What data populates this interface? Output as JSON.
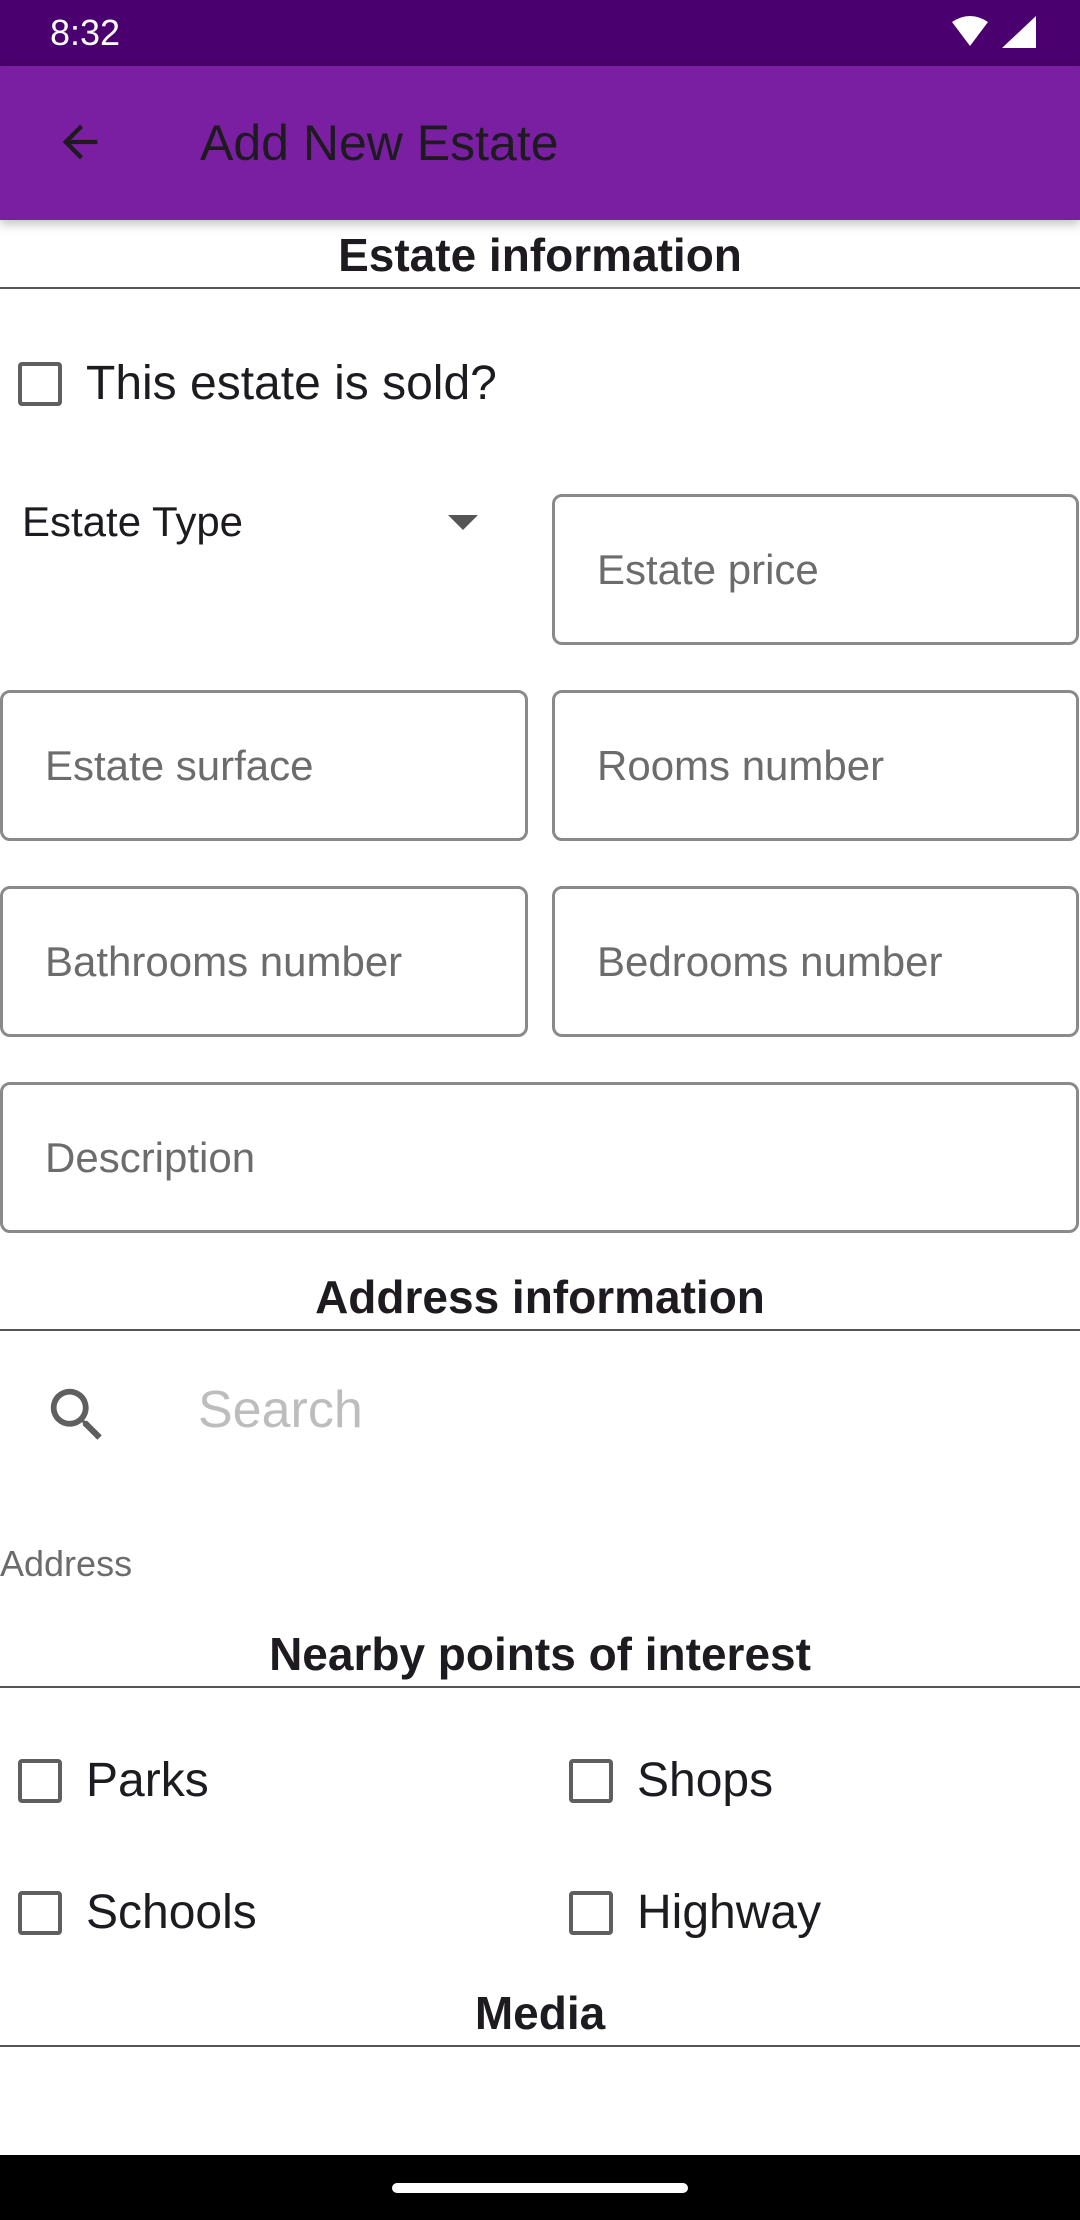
{
  "status_bar": {
    "time": "8:32",
    "icons": [
      "wifi-icon",
      "cell-signal-icon"
    ]
  },
  "app_bar": {
    "title": "Add New Estate",
    "back_icon": "arrow-back-icon",
    "background": "#7b1fa2",
    "status_background": "#4a006e"
  },
  "estate_section": {
    "title": "Estate information",
    "sold_checkbox": {
      "label": "This estate is sold?",
      "checked": false
    },
    "type_dropdown": {
      "label": "Estate Type"
    },
    "fields": {
      "price": {
        "placeholder": "Estate price",
        "value": ""
      },
      "surface": {
        "placeholder": "Estate surface",
        "value": ""
      },
      "rooms": {
        "placeholder": "Rooms number",
        "value": ""
      },
      "bathrooms": {
        "placeholder": "Bathrooms number",
        "value": ""
      },
      "bedrooms": {
        "placeholder": "Bedrooms number",
        "value": ""
      },
      "description": {
        "placeholder": "Description",
        "value": ""
      }
    }
  },
  "address_section": {
    "title": "Address information",
    "search": {
      "placeholder": "Search",
      "value": ""
    },
    "address_label": "Address"
  },
  "poi_section": {
    "title": "Nearby points of interest",
    "items": [
      {
        "label": "Parks",
        "checked": false
      },
      {
        "label": "Shops",
        "checked": false
      },
      {
        "label": "Schools",
        "checked": false
      },
      {
        "label": "Highway",
        "checked": false
      }
    ]
  },
  "media_section": {
    "title": "Media"
  }
}
